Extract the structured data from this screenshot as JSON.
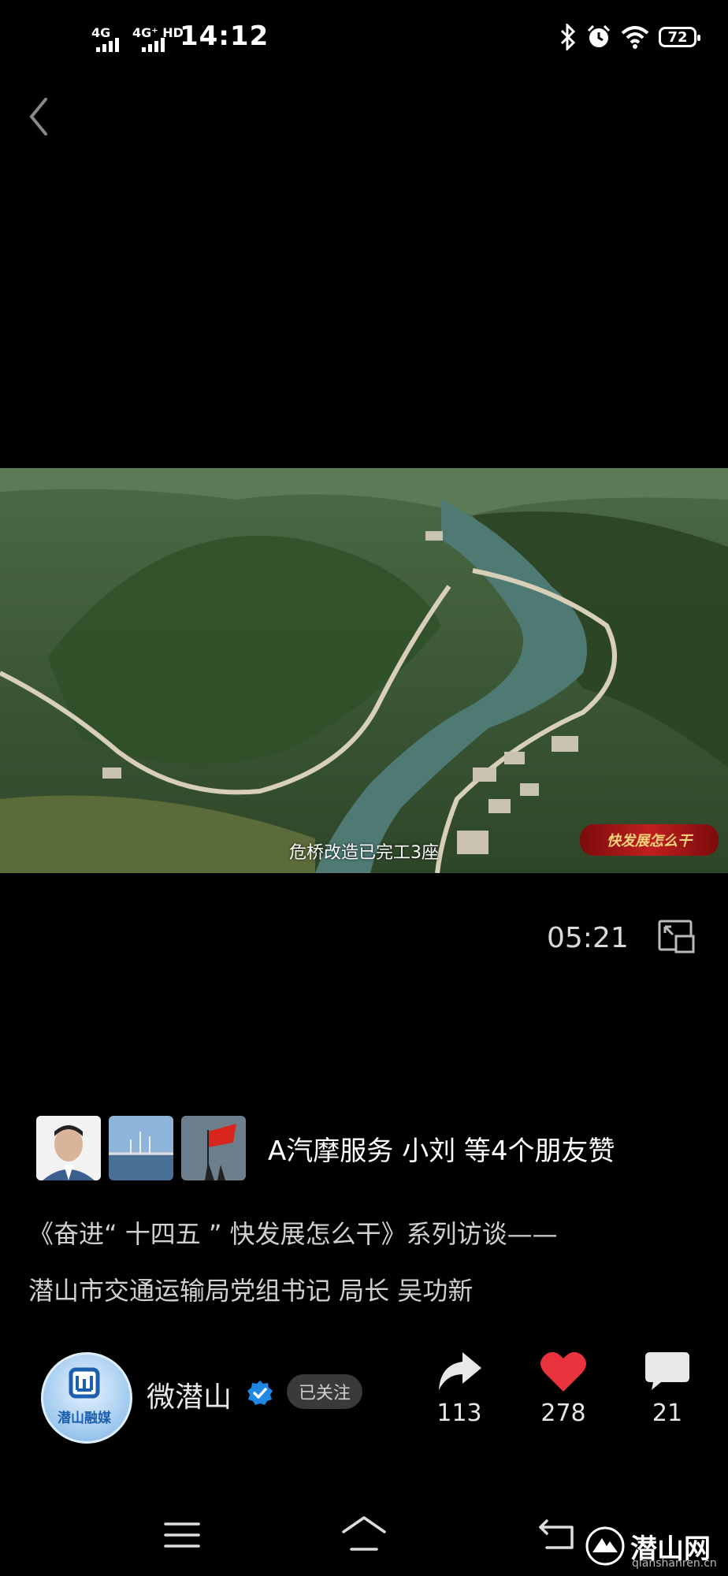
{
  "status_bar": {
    "signal_1": "4G",
    "signal_2": "4G⁺ HD",
    "time": "14:12",
    "battery": "72",
    "icons": [
      "bluetooth-icon",
      "alarm-icon",
      "wifi-icon",
      "battery-icon"
    ]
  },
  "video": {
    "subtitle": "危桥改造已完工3座",
    "watermark": "快发展怎么干",
    "duration": "05:21"
  },
  "likes": {
    "text": "A汽摩服务  小刘  等4个朋友赞"
  },
  "post": {
    "title_line1": "《奋进“ 十四五 ” 快发展怎么干》系列访谈——",
    "title_line2": "潜山市交通运输局党组书记 局长 吴功新"
  },
  "author": {
    "name": "微潜山",
    "avatar_label": "潜山融媒",
    "follow_status": "已关注"
  },
  "actions": {
    "share_count": "113",
    "like_count": "278",
    "comment_count": "21"
  },
  "site": {
    "name": "潜山网",
    "url": "qianshanren.cn"
  },
  "colors": {
    "like_red": "#e8323c",
    "verified_blue": "#1e88e5"
  }
}
